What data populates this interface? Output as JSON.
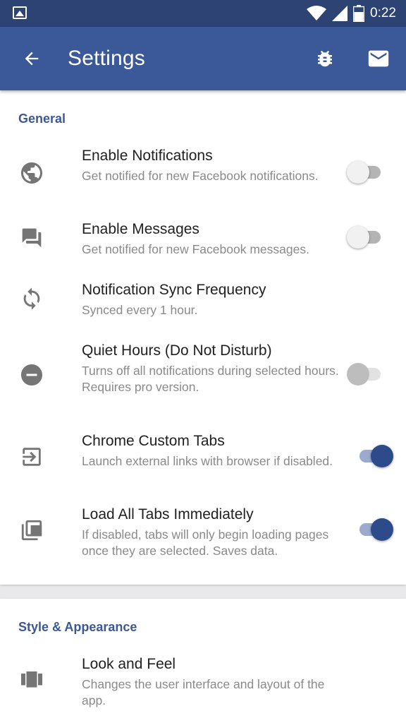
{
  "status_bar": {
    "time": "0:22",
    "battery_level": "36"
  },
  "app_bar": {
    "title": "Settings"
  },
  "colors": {
    "primary": "#3b5998",
    "primary_dark": "#2d4373",
    "accent": "#2d4a8a"
  },
  "sections": [
    {
      "title": "General",
      "items": [
        {
          "icon": "globe-icon",
          "title": "Enable Notifications",
          "summary": "Get notified for new Facebook notifications.",
          "switch": "off"
        },
        {
          "icon": "chat-icon",
          "title": "Enable Messages",
          "summary": "Get notified for new Facebook messages.",
          "switch": "off"
        },
        {
          "icon": "sync-icon",
          "title": "Notification Sync Frequency",
          "summary": "Synced every 1 hour."
        },
        {
          "icon": "minus-circle-icon",
          "title": "Quiet Hours (Do Not Disturb)",
          "summary": "Turns off all notifications during selected hours.",
          "summary_2": "Requires pro version.",
          "switch": "off-disabled"
        },
        {
          "icon": "exit-to-app-icon",
          "title": "Chrome Custom Tabs",
          "summary": "Launch external links with browser if disabled.",
          "switch": "on"
        },
        {
          "icon": "library-icon",
          "title": "Load All Tabs Immediately",
          "summary": "If disabled, tabs will only begin loading pages once they are selected. Saves data.",
          "switch": "on"
        }
      ]
    },
    {
      "title": "Style & Appearance",
      "items": [
        {
          "icon": "view-carousel-icon",
          "title": "Look and Feel",
          "summary": "Changes the user interface and layout of the app."
        }
      ]
    }
  ]
}
